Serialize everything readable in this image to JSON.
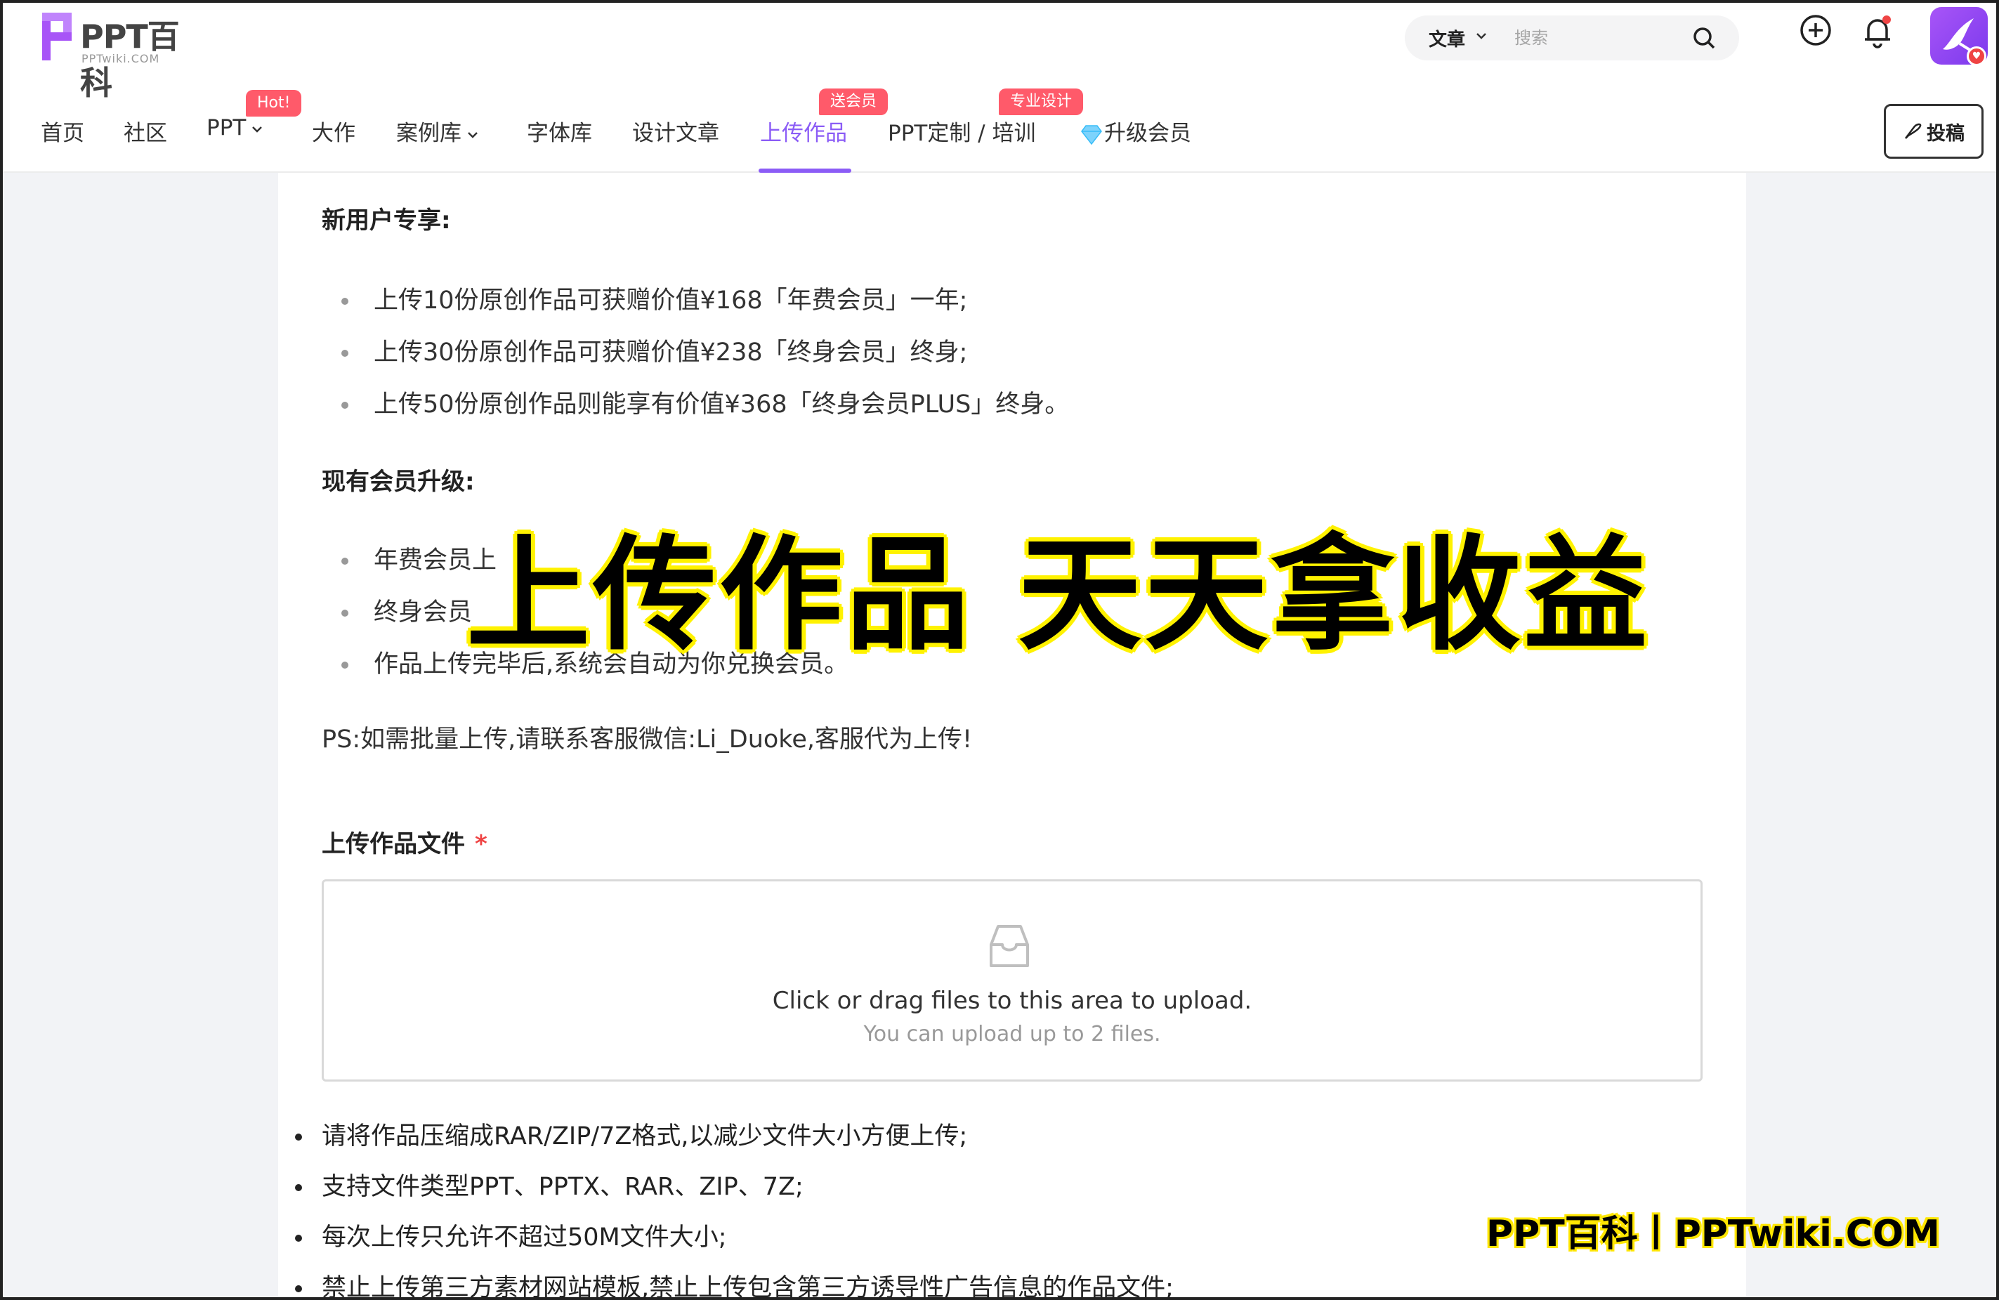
{
  "header": {
    "logo": {
      "brand": "PPT百科",
      "domain": "PPTwiki.COM"
    },
    "search": {
      "type_label": "文章",
      "placeholder": "搜索"
    }
  },
  "nav": {
    "items": [
      {
        "label": "首页"
      },
      {
        "label": "社区"
      },
      {
        "label": "PPT",
        "badge": "Hot!"
      },
      {
        "label": "大作"
      },
      {
        "label": "案例库"
      },
      {
        "label": "字体库"
      },
      {
        "label": "设计文章"
      },
      {
        "label": "上传作品",
        "badge": "送会员",
        "active": true
      },
      {
        "label": "PPT定制 / 培训",
        "badge": "专业设计"
      },
      {
        "label": "升级会员"
      }
    ],
    "contribute_label": "投稿"
  },
  "content": {
    "new_user_title": "新用户专享:",
    "new_user_perks": [
      "上传10份原创作品可获赠价值¥168「年费会员」一年;",
      "上传30份原创作品可获赠价值¥238「终身会员」终身;",
      "上传50份原创作品则能享有价值¥368「终身会员PLUS」终身。"
    ],
    "existing_title": "现有会员升级:",
    "existing_perks": [
      "年费会员上",
      "终身会员",
      "作品上传完毕后,系统会自动为你兑换会员。"
    ],
    "ps_note": "PS:如需批量上传,请联系客服微信:Li_Duoke,客服代为上传!",
    "upload": {
      "label": "上传作品文件",
      "required_mark": "*",
      "dropzone_text": "Click or drag files to this area to upload.",
      "dropzone_hint": "You can upload up to 2 files."
    },
    "rules": [
      "请将作品压缩成RAR/ZIP/7Z格式,以减少文件大小方便上传;",
      "支持文件类型PPT、PPTX、RAR、ZIP、7Z;",
      "每次上传只允许不超过50M文件大小;",
      "禁止上传第三方素材网站模板,禁止上传包含第三方诱导性广告信息的作品文件;"
    ]
  },
  "overlay": {
    "headline": "上传作品 天天拿收益",
    "watermark": "PPT百科丨PPTwiki.COM"
  },
  "colors": {
    "accent": "#8b5cf6",
    "badge": "#ff5a6a",
    "highlight": "#fff200"
  }
}
